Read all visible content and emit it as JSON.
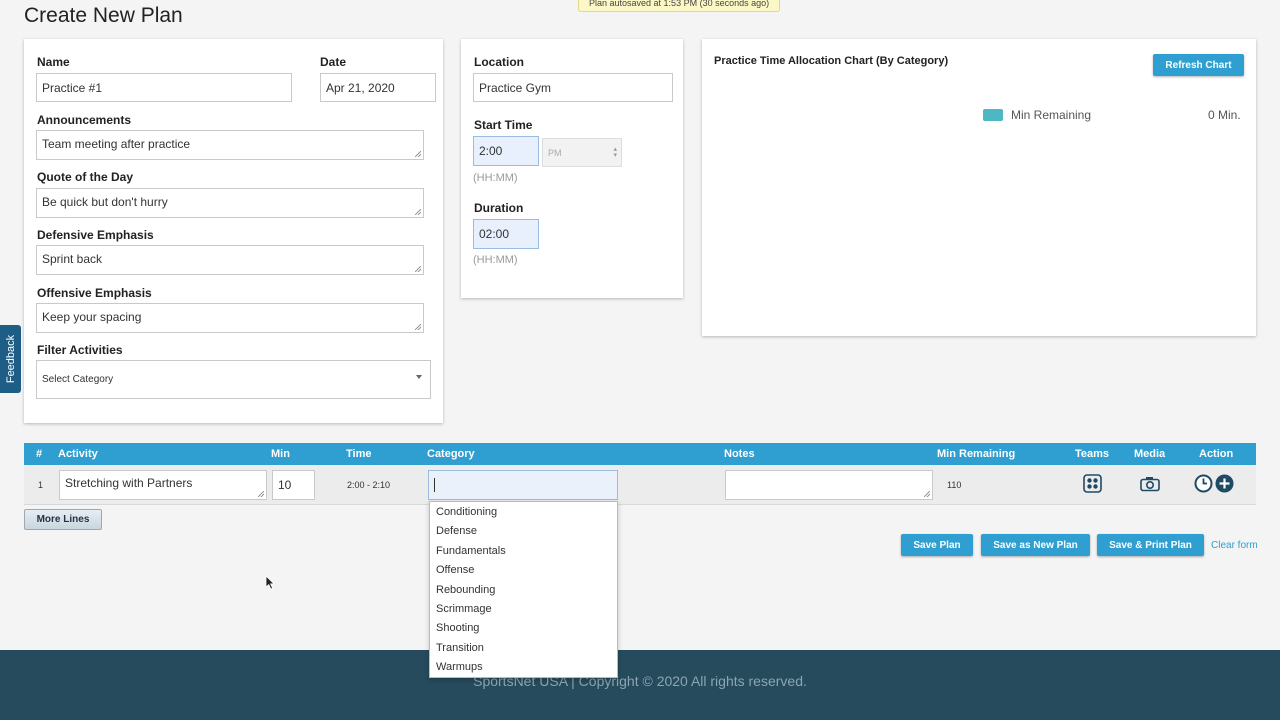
{
  "page": {
    "title": "Create New Plan",
    "autosave": "Plan autosaved at 1:53 PM (30 seconds ago)"
  },
  "feedback": "Feedback",
  "form": {
    "name_label": "Name",
    "name_value": "Practice #1",
    "date_label": "Date",
    "date_value": "Apr 21, 2020",
    "announcements_label": "Announcements",
    "announcements_value": "Team meeting after practice",
    "quote_label": "Quote of the Day",
    "quote_value": "Be quick but don't hurry",
    "defensive_label": "Defensive Emphasis",
    "defensive_value": "Sprint back",
    "offensive_label": "Offensive Emphasis",
    "offensive_value": "Keep your spacing",
    "filter_label": "Filter Activities",
    "filter_value": "Select Category"
  },
  "location": {
    "location_label": "Location",
    "location_value": "Practice Gym",
    "start_label": "Start Time",
    "start_value": "2:00",
    "ampm_value": "PM",
    "start_hint": "(HH:MM)",
    "duration_label": "Duration",
    "duration_value": "02:00",
    "duration_hint": "(HH:MM)"
  },
  "chart": {
    "title": "Practice Time Allocation Chart (By Category)",
    "refresh_label": "Refresh Chart",
    "legend_color": "#4db8c4",
    "legend_label": "Min Remaining",
    "legend_value": "0 Min."
  },
  "table": {
    "headers": {
      "num": "#",
      "activity": "Activity",
      "min": "Min",
      "time": "Time",
      "category": "Category",
      "notes": "Notes",
      "remaining": "Min Remaining",
      "teams": "Teams",
      "media": "Media",
      "action": "Action"
    },
    "row": {
      "num": "1",
      "activity": "Stretching with Partners",
      "min": "10",
      "time": "2:00 - 2:10",
      "category": "",
      "notes": "",
      "remaining": "110"
    },
    "icons": {
      "teams": "teams-icon",
      "media": "camera-icon",
      "clock": "clock-icon",
      "add": "plus-circle-icon"
    }
  },
  "dropdown": {
    "options": [
      "Conditioning",
      "Defense",
      "Fundamentals",
      "Offense",
      "Rebounding",
      "Scrimmage",
      "Shooting",
      "Transition",
      "Warmups"
    ]
  },
  "buttons": {
    "more_lines": "More Lines",
    "save_plan": "Save Plan",
    "save_new": "Save as New Plan",
    "save_print": "Save & Print Plan",
    "clear_form": "Clear form"
  },
  "footer": {
    "text": "SportsNet USA | Copyright © 2020 All rights reserved."
  },
  "colors": {
    "accent": "#2e9fd0",
    "footer_bg": "#264b5c",
    "feedback_bg": "#1d5d86",
    "icon": "#1e4a63"
  }
}
